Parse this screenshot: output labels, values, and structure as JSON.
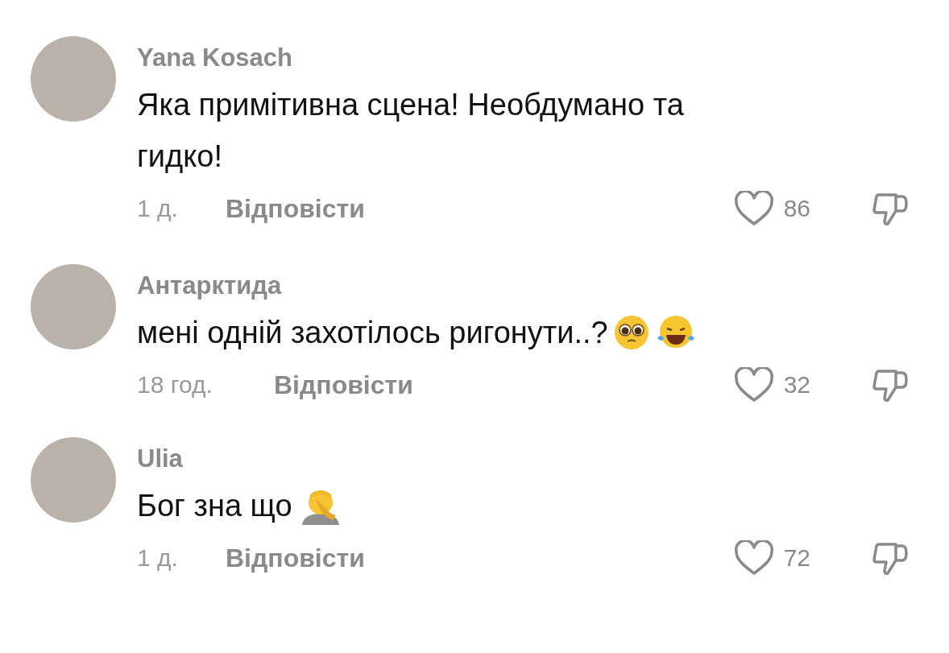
{
  "comments": [
    {
      "author": "Yana Kosach",
      "text": "Яка примітивна сцена! Необдумано та гидко!",
      "time": "1 д.",
      "reply": "Відповісти",
      "likes": "86",
      "liked": false
    },
    {
      "author": "Антарктида",
      "text": "мені одній захотілось ригонути..?",
      "emoji": [
        {
          "kind": "pleading-face"
        },
        {
          "kind": "tears-of-joy"
        }
      ],
      "time": "18 год.",
      "reply": "Відповісти",
      "likes": "32",
      "liked": false
    },
    {
      "author": "Ulia",
      "text": "Бог зна що",
      "emoji": [
        {
          "kind": "facepalm"
        }
      ],
      "time": "1 д.",
      "reply": "Відповісти",
      "likes": "72",
      "liked": false
    }
  ]
}
